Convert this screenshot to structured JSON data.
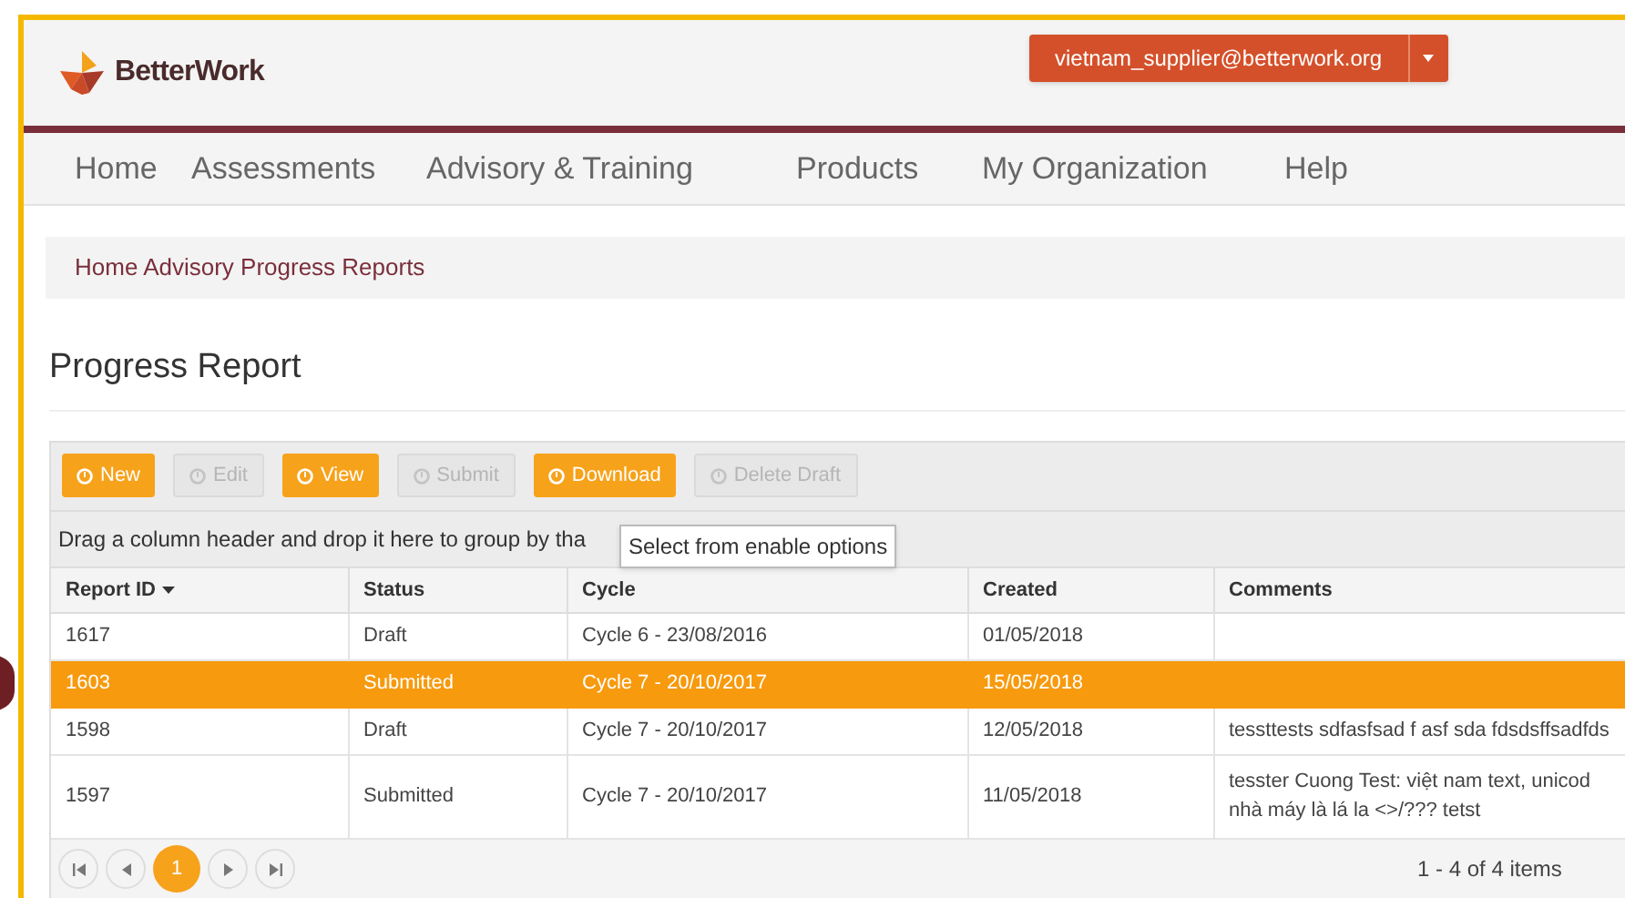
{
  "logo": {
    "text": "BetterWork"
  },
  "user_menu": {
    "label": "vietnam_supplier@betterwork.org"
  },
  "nav": [
    {
      "label": "Home"
    },
    {
      "label": "Assessments"
    },
    {
      "label": "Advisory & Training"
    },
    {
      "label": "Products"
    },
    {
      "label": "My Organization"
    },
    {
      "label": "Help"
    }
  ],
  "breadcrumb": "Home Advisory Progress Reports",
  "page_title": "Progress Report",
  "toolbar": [
    {
      "label": "New",
      "disabled": false
    },
    {
      "label": "Edit",
      "disabled": true
    },
    {
      "label": "View",
      "disabled": false
    },
    {
      "label": "Submit",
      "disabled": true
    },
    {
      "label": "Download",
      "disabled": false
    },
    {
      "label": "Delete Draft",
      "disabled": true
    }
  ],
  "group_hint": "Drag a column header and drop it here to group by tha",
  "tooltip": "Select from enable options",
  "table": {
    "columns": [
      "Report ID",
      "Status",
      "Cycle",
      "Created",
      "Comments"
    ],
    "rows": [
      {
        "cells": [
          "1617",
          "Draft",
          "Cycle 6 - 23/08/2016",
          "01/05/2018",
          ""
        ],
        "selected": false
      },
      {
        "cells": [
          "1603",
          "Submitted",
          "Cycle 7 - 20/10/2017",
          "15/05/2018",
          ""
        ],
        "selected": true
      },
      {
        "cells": [
          "1598",
          "Draft",
          "Cycle 7 - 20/10/2017",
          "12/05/2018",
          "tessttests sdfasfsad f asf sda fdsdsffsadfds"
        ],
        "selected": false
      },
      {
        "cells": [
          "1597",
          "Submitted",
          "Cycle 7 - 20/10/2017",
          "11/05/2018",
          "tesster Cuong Test: việt nam text, unicod nhà máy là lá la <>/??? tetst"
        ],
        "selected": false
      }
    ]
  },
  "pager": {
    "pages": [
      {
        "label": "1",
        "selected": true
      }
    ],
    "summary": "1 - 4 of 4 items"
  }
}
